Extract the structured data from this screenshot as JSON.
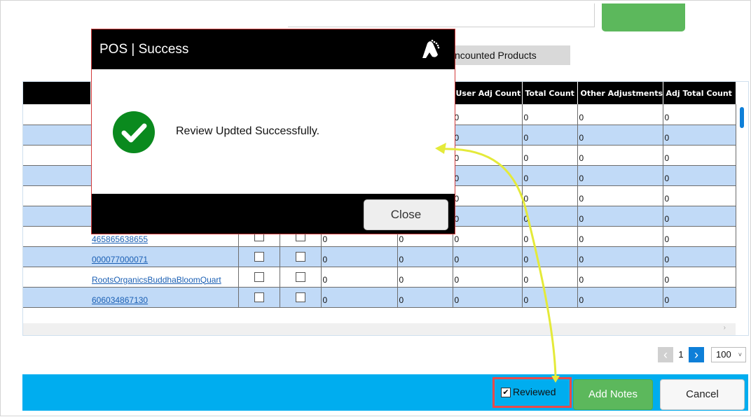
{
  "uncounted_tab": {
    "label": "ncounted Products"
  },
  "grid": {
    "columns": [
      "",
      "",
      "",
      "",
      "",
      "",
      "User Adj Count",
      "Total Count",
      "Other Adjustments",
      "Adj Total Count"
    ],
    "rows": [
      {
        "product": "",
        "vals": [
          "",
          "",
          "0",
          "0",
          "0",
          "0"
        ]
      },
      {
        "product": "",
        "vals": [
          "",
          "",
          "0",
          "0",
          "0",
          "0"
        ]
      },
      {
        "product": "",
        "vals": [
          "",
          "",
          "0",
          "0",
          "0",
          "0"
        ]
      },
      {
        "product": "",
        "vals": [
          "",
          "",
          "0",
          "0",
          "0",
          "0"
        ]
      },
      {
        "product": "",
        "vals": [
          "",
          "",
          "0",
          "0",
          "0",
          "0"
        ]
      },
      {
        "product": "",
        "vals": [
          "",
          "",
          "0",
          "0",
          "0",
          "0"
        ]
      },
      {
        "product": "465865638655",
        "vals": [
          "0",
          "0",
          "0",
          "0",
          "0",
          "0"
        ]
      },
      {
        "product": "000077000071",
        "vals": [
          "0",
          "0",
          "0",
          "0",
          "0",
          "0"
        ]
      },
      {
        "product": "RootsOrganicsBuddhaBloomQuart",
        "vals": [
          "0",
          "0",
          "0",
          "0",
          "0",
          "0"
        ]
      },
      {
        "product": "606034867130",
        "vals": [
          "0",
          "0",
          "0",
          "0",
          "0",
          "0"
        ]
      }
    ]
  },
  "pager": {
    "prev_icon": "chevron-left-icon",
    "page": "1",
    "next_icon": "chevron-right-icon",
    "page_size": "100"
  },
  "footer": {
    "reviewed_label": "Reviewed",
    "reviewed_checked": true,
    "add_notes_label": "Add Notes",
    "cancel_label": "Cancel"
  },
  "modal": {
    "title": "POS | Success",
    "message": "Review Updted Successfully.",
    "close_label": "Close",
    "success_color": "#0a8a1e"
  },
  "colors": {
    "accent_blue": "#00adef",
    "row_alt": "#c1daf7",
    "green_button": "#5cb85c",
    "annotation_highlight": "#e84a4a",
    "annotation_arrow": "#e4ea3a"
  }
}
